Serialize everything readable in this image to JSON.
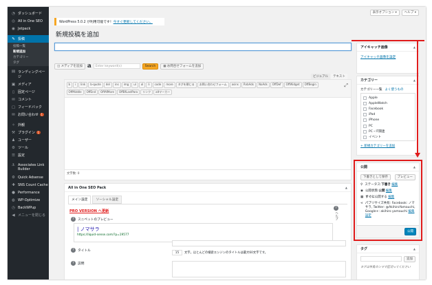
{
  "sidebar": {
    "items_top": [
      {
        "icon": "◔",
        "label": "ダッシュボード"
      },
      {
        "icon": "◎",
        "label": "All in One SEO"
      },
      {
        "icon": "◉",
        "label": "Jetpack"
      }
    ],
    "active": {
      "icon": "✎",
      "label": "投稿"
    },
    "subitems": [
      {
        "label": "投稿一覧"
      },
      {
        "label": "新規追加"
      },
      {
        "label": "カテゴリー"
      },
      {
        "label": "タグ"
      }
    ],
    "items_mid": [
      {
        "icon": "▤",
        "label": "ランディングペー",
        "line2": "ジ"
      },
      {
        "icon": "▣",
        "label": "メディア"
      },
      {
        "icon": "▯",
        "label": "固定ページ"
      },
      {
        "icon": "✉",
        "label": "コメント"
      },
      {
        "icon": "▢",
        "label": "フィードバック"
      },
      {
        "icon": "✉",
        "label": "お問い合わせ",
        "badge": "1"
      }
    ],
    "items_bottom": [
      {
        "icon": "✧",
        "label": "外観"
      },
      {
        "icon": "⚒",
        "label": "プラグイン",
        "badge": "1"
      },
      {
        "icon": "♟",
        "label": "ユーザー"
      },
      {
        "icon": "⚙",
        "label": "ツール"
      },
      {
        "icon": "☰",
        "label": "設定"
      }
    ],
    "plugins": [
      {
        "icon": "⚓",
        "label": "Associates Link",
        "line2": "Builder"
      },
      {
        "icon": "⚙",
        "label": "Quick Adsense"
      },
      {
        "icon": "✚",
        "label": "SNS Count Cache"
      },
      {
        "icon": "●",
        "label": "Performance"
      },
      {
        "icon": "◍",
        "label": "WP-Optimize"
      },
      {
        "icon": "◷",
        "label": "BackWPup"
      },
      {
        "icon": "◀",
        "label": "メニューを閉じる"
      }
    ]
  },
  "top": {
    "display_options": "表示オプション ▾",
    "help": "ヘルプ ▾"
  },
  "notice": {
    "text": "WordPress 5.0.2 が利用可能です！",
    "link": "今すぐ更新してください。"
  },
  "page_title": "新規投稿を追加",
  "toolbar": {
    "media_button": "メディアを追加",
    "amazon_icon": "a",
    "keyword_placeholder": "Enter keyword(s)",
    "search_button": "Search",
    "form_button": "お問合せフォームを追加",
    "tab_visual": "ビジュアル",
    "tab_text": "テキスト"
  },
  "quicktags_row1": [
    "b",
    "i",
    "link",
    "b-quote",
    "del",
    "ins",
    "img",
    "ul",
    "ol",
    "li",
    "code",
    "more",
    "タグを閉じる",
    "お問い合わせフォーム",
    "asins",
    "RnbAds",
    "NoAds",
    "OffDef",
    "OffWidget",
    "OffBegin"
  ],
  "quicktags_row2": [
    "OffMiddle",
    "OffEnd",
    "OffAfMore",
    "OffBfLastPara",
    "リンク",
    "altマーカー"
  ],
  "word_count": "文字数: 0",
  "seo": {
    "title": "All in One SEO Pack",
    "tab_main": "メイン設定",
    "tab_social": "ソーシャル設定",
    "pro_link": "PRO VERSION へ更新",
    "help_label": "ヘルプ",
    "snippet_label": "スニペットのプレビュー",
    "snippet_title": "| ノマサラ",
    "snippet_url": "https://liquid-sense.com/?p=19577",
    "title_label": "タイトル",
    "count_value": "15",
    "count_text": "文字。ほとんどの検索エンジンのタイトルは最大60文字です。",
    "desc_label": "説明"
  },
  "featured": {
    "title": "アイキャッチ画像",
    "link": "アイキャッチ画像を設定"
  },
  "category": {
    "title": "カテゴリー",
    "tab_all": "カテゴリー一覧",
    "tab_pop": "よく使うもの",
    "items": [
      "Apple",
      "AppleWatch",
      "Facebook",
      "iPad",
      "iPhone",
      "PC",
      "PC・IT関連",
      "イベント"
    ],
    "add_link": "+ 新規カテゴリーを追加"
  },
  "publish": {
    "title": "公開",
    "save_draft": "下書きとして保存",
    "preview": "プレビュー",
    "status_label": "ステータス:",
    "status_value": "下書き",
    "edit1": "編集",
    "visibility_label": "公開状態:",
    "visibility_value": "公開",
    "edit2": "編集",
    "schedule_label": "すぐに",
    "schedule_rest": "公開する",
    "edit3": "編集",
    "share_text": "パブリサイズ共有: Facebook: ノマサラ, Twitter: @AkihiroYamauchi, Google+: akihiro yamauchi",
    "edit4": "編集",
    "settings": "設定",
    "publish_button": "公開"
  },
  "tags": {
    "title": "タグ",
    "add_button": "追加",
    "hint": "タグは半角カンマで区切ってください"
  },
  "colors": {
    "accent": "#0073aa",
    "sidebar": "#23282d",
    "highlight": "#e01b1b",
    "orange": "#f6a623"
  }
}
